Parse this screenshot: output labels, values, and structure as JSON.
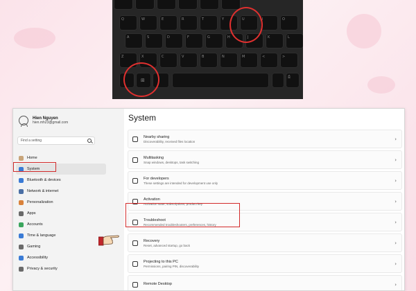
{
  "keyboard": {
    "keys_row1": [
      "3",
      "4",
      "5",
      "6",
      "7",
      "8"
    ],
    "keys_row2": [
      "Q",
      "W",
      "E",
      "R",
      "T",
      "Y",
      "U",
      "I",
      "O"
    ],
    "keys_row3": [
      "A",
      "S",
      "D",
      "F",
      "G",
      "H",
      "J",
      "K",
      "L"
    ],
    "keys_row4": [
      "Z",
      "X",
      "C",
      "V",
      "B",
      "N",
      "M",
      "<",
      ">"
    ],
    "keys_row5": [
      "",
      "⊞",
      "",
      "",
      "",
      "⎙"
    ]
  },
  "user": {
    "name": "Hien Nguyen",
    "email": "hien.mh23@gmail.com"
  },
  "search": {
    "placeholder": "Find a setting"
  },
  "nav": [
    {
      "label": "Home",
      "color": "#c8a57a"
    },
    {
      "label": "System",
      "color": "#3a7bd5",
      "active": true
    },
    {
      "label": "Bluetooth & devices",
      "color": "#3a7bd5"
    },
    {
      "label": "Network & internet",
      "color": "#4a6fa5"
    },
    {
      "label": "Personalization",
      "color": "#d9823b"
    },
    {
      "label": "Apps",
      "color": "#6a6a6a"
    },
    {
      "label": "Accounts",
      "color": "#3aa55d"
    },
    {
      "label": "Time & language",
      "color": "#3a7bd5"
    },
    {
      "label": "Gaming",
      "color": "#6a6a6a"
    },
    {
      "label": "Accessibility",
      "color": "#3a7bd5"
    },
    {
      "label": "Privacy & security",
      "color": "#6a6a6a"
    }
  ],
  "page": {
    "title": "System"
  },
  "settings": [
    {
      "title": "Nearby sharing",
      "sub": "Discoverability, received files location"
    },
    {
      "title": "Multitasking",
      "sub": "Snap windows, desktops, task switching"
    },
    {
      "title": "For developers",
      "sub": "These settings are intended for development use only"
    },
    {
      "title": "Activation",
      "sub": "Activation state, subscriptions, product key"
    },
    {
      "title": "Troubleshoot",
      "sub": "Recommended troubleshooters, preferences, history"
    },
    {
      "title": "Recovery",
      "sub": "Reset, advanced startup, go back"
    },
    {
      "title": "Projecting to this PC",
      "sub": "Permissions, pairing PIN, discoverability"
    },
    {
      "title": "Remote Desktop",
      "sub": ""
    }
  ],
  "colors": {
    "highlight": "#d22a2a",
    "accent": "#3a7bd5",
    "background": "#fbe3ea"
  }
}
